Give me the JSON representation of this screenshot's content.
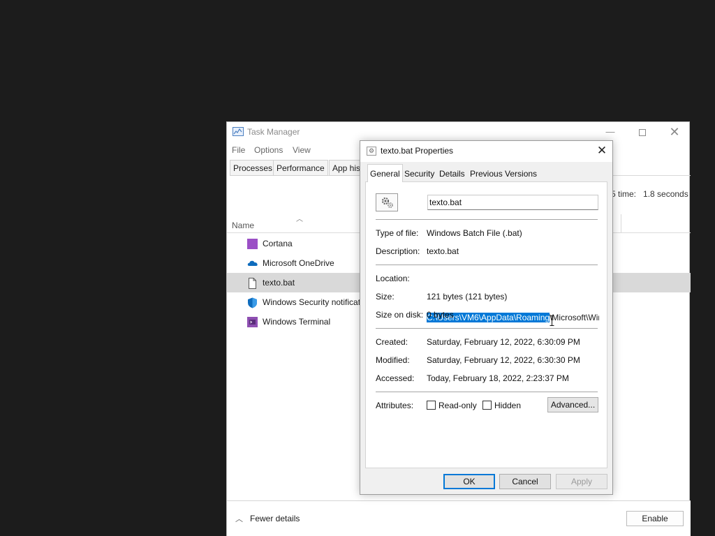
{
  "task_manager": {
    "title": "Task Manager",
    "menu": [
      "File",
      "Options",
      "View"
    ],
    "tabs": [
      "Processes",
      "Performance",
      "App his"
    ],
    "cpu_time_label": "5 time:",
    "cpu_time_value": "1.8 seconds",
    "column_name": "Name",
    "rows": [
      {
        "label": "Cortana",
        "icon": "cortana-icon",
        "color": "#9b4fc6"
      },
      {
        "label": "Microsoft OneDrive",
        "icon": "onedrive-cloud-icon",
        "color": "#0f6cbd"
      },
      {
        "label": "texto.bat",
        "icon": "document-icon",
        "selected": true
      },
      {
        "label": "Windows Security notificat",
        "icon": "shield-icon",
        "color": "#0f6cbd"
      },
      {
        "label": "Windows Terminal",
        "icon": "terminal-icon",
        "color": "#8e4fb2"
      }
    ],
    "footer": {
      "fewer_details": "Fewer details",
      "enable_button": "Enable"
    }
  },
  "properties_dialog": {
    "title": "texto.bat Properties",
    "tabs": [
      "General",
      "Security",
      "Details",
      "Previous Versions"
    ],
    "active_tab": "General",
    "file_name": "texto.bat",
    "type_of_file_label": "Type of file:",
    "type_of_file_value": "Windows Batch File (.bat)",
    "description_label": "Description:",
    "description_value": "texto.bat",
    "location_label": "Location:",
    "location_selected": "C:\\Users\\VM6\\AppData\\Roaming",
    "location_rest": "\\Microsoft\\Windo",
    "size_label": "Size:",
    "size_value": "121 bytes (121 bytes)",
    "size_on_disk_label": "Size on disk:",
    "size_on_disk_value": "0 bytes",
    "created_label": "Created:",
    "created_value": "Saturday, February 12, 2022, 6:30:09 PM",
    "modified_label": "Modified:",
    "modified_value": "Saturday, February 12, 2022, 6:30:30 PM",
    "accessed_label": "Accessed:",
    "accessed_value": "Today, February 18, 2022, 2:23:37 PM",
    "attributes_label": "Attributes:",
    "read_only_label": "Read-only",
    "hidden_label": "Hidden",
    "advanced_button": "Advanced...",
    "ok_button": "OK",
    "cancel_button": "Cancel",
    "apply_button": "Apply",
    "selection_color": "#0078d7"
  }
}
